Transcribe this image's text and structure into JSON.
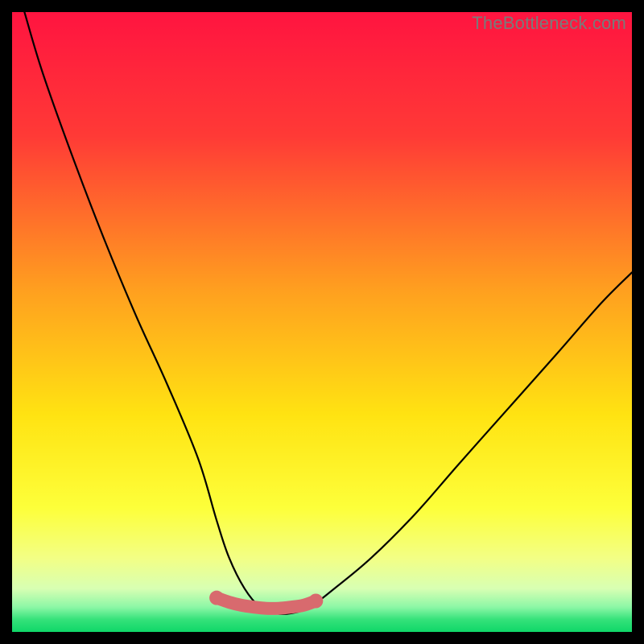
{
  "watermark": "TheBottleneck.com",
  "chart_data": {
    "type": "line",
    "title": "",
    "xlabel": "",
    "ylabel": "",
    "xlim": [
      0,
      100
    ],
    "ylim": [
      0,
      100
    ],
    "series": [
      {
        "name": "bottleneck-curve",
        "x": [
          2,
          5,
          10,
          15,
          20,
          25,
          30,
          33,
          35,
          37.5,
          40,
          42.5,
          45,
          48,
          52,
          58,
          65,
          72,
          80,
          88,
          95,
          100
        ],
        "values": [
          100,
          90,
          76,
          63,
          51,
          40,
          28,
          18,
          12,
          7,
          4,
          3,
          3,
          4,
          7,
          12,
          19,
          27,
          36,
          45,
          53,
          58
        ]
      },
      {
        "name": "optimal-band",
        "x": [
          33,
          35,
          37,
          39,
          41,
          43,
          45,
          47,
          49
        ],
        "values": [
          5.5,
          4.8,
          4.3,
          4.0,
          3.8,
          3.8,
          4.0,
          4.3,
          5.0
        ]
      }
    ],
    "gradient_stops": [
      {
        "pos": 0,
        "color": "#ff1440"
      },
      {
        "pos": 20,
        "color": "#ff3a36"
      },
      {
        "pos": 45,
        "color": "#ffa01f"
      },
      {
        "pos": 65,
        "color": "#ffe312"
      },
      {
        "pos": 80,
        "color": "#fdff3a"
      },
      {
        "pos": 88,
        "color": "#f3ff84"
      },
      {
        "pos": 93,
        "color": "#d8ffb3"
      },
      {
        "pos": 96,
        "color": "#8cf7a6"
      },
      {
        "pos": 98,
        "color": "#35e27a"
      },
      {
        "pos": 100,
        "color": "#0fd768"
      }
    ],
    "optimal_band_color": "#d86a6e"
  }
}
